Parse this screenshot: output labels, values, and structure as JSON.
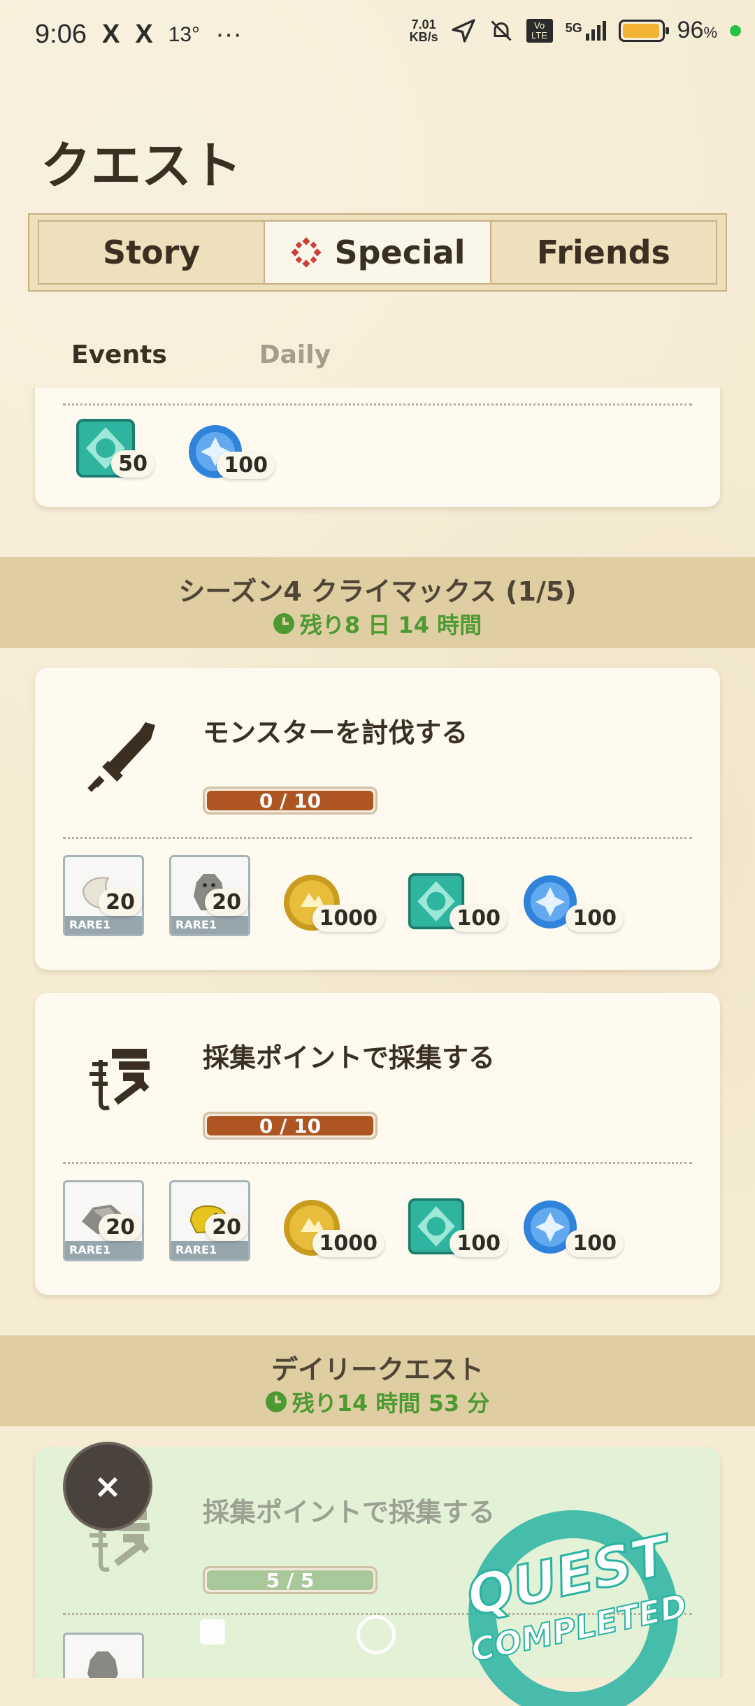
{
  "status_bar": {
    "time": "9:06",
    "x_icon_1": "X",
    "x_icon_2": "X",
    "temperature": "13°",
    "more": "···",
    "speed_value": "7.01",
    "speed_unit": "KB/s",
    "volte": "Vo LTE",
    "network": "5G",
    "battery_percent": "96",
    "battery_unit": "%",
    "battery_level": 0.96
  },
  "page": {
    "title": "クエスト"
  },
  "tabs": [
    {
      "label": "Story",
      "active": false
    },
    {
      "label": "Special",
      "active": true,
      "icon": "special-diamond-icon"
    },
    {
      "label": "Friends",
      "active": false
    }
  ],
  "sub_tabs": [
    {
      "label": "Events",
      "active": true
    },
    {
      "label": "Daily",
      "active": false
    }
  ],
  "top_card": {
    "rewards": [
      {
        "icon": "green-ticket-icon",
        "count": "50"
      },
      {
        "icon": "blue-orb-icon",
        "count": "100"
      }
    ]
  },
  "season_section": {
    "title": "シーズン4 クライマックス (1/5)",
    "timer": "残り8 日 14 時間"
  },
  "quests": [
    {
      "title": "モンスターを討伐する",
      "icon": "sword-icon",
      "progress_text": "0 / 10",
      "progress_fraction": 0,
      "rewards": [
        {
          "type": "item",
          "icon": "claw-item-icon",
          "rarity": "RARE1",
          "count": "20"
        },
        {
          "type": "item",
          "icon": "monster-figure-icon",
          "rarity": "RARE1",
          "count": "20"
        },
        {
          "type": "currency",
          "icon": "gold-coin-icon",
          "count": "1000"
        },
        {
          "type": "currency",
          "icon": "green-ticket-icon",
          "count": "100"
        },
        {
          "type": "currency",
          "icon": "blue-orb-icon",
          "count": "100"
        }
      ]
    },
    {
      "title": "採集ポイントで採集する",
      "icon": "gathering-icon",
      "progress_text": "0 / 10",
      "progress_fraction": 0,
      "rewards": [
        {
          "type": "item",
          "icon": "ore-item-icon",
          "rarity": "RARE1",
          "count": "20"
        },
        {
          "type": "item",
          "icon": "yellow-creature-icon",
          "rarity": "RARE1",
          "count": "20"
        },
        {
          "type": "currency",
          "icon": "gold-coin-icon",
          "count": "1000"
        },
        {
          "type": "currency",
          "icon": "green-ticket-icon",
          "count": "100"
        },
        {
          "type": "currency",
          "icon": "blue-orb-icon",
          "count": "100"
        }
      ]
    }
  ],
  "daily_section": {
    "title": "デイリークエスト",
    "timer": "残り14 時間 53 分"
  },
  "daily_quest": {
    "title": "採集ポイントで採集する",
    "icon": "gathering-icon",
    "progress_text": "5 / 5",
    "progress_fraction": 1,
    "completed": true,
    "stamp_line1": "QUEST",
    "stamp_line2": "COMPLETED"
  },
  "overlay": {
    "close_label": "×"
  },
  "colors": {
    "background": "#f6ecd4",
    "card": "#fffaf0",
    "progress_fill": "#ad5622",
    "completed_card": "#e3f1d6",
    "timer_green": "#4d9a32",
    "section_band": "#e0cea3"
  }
}
